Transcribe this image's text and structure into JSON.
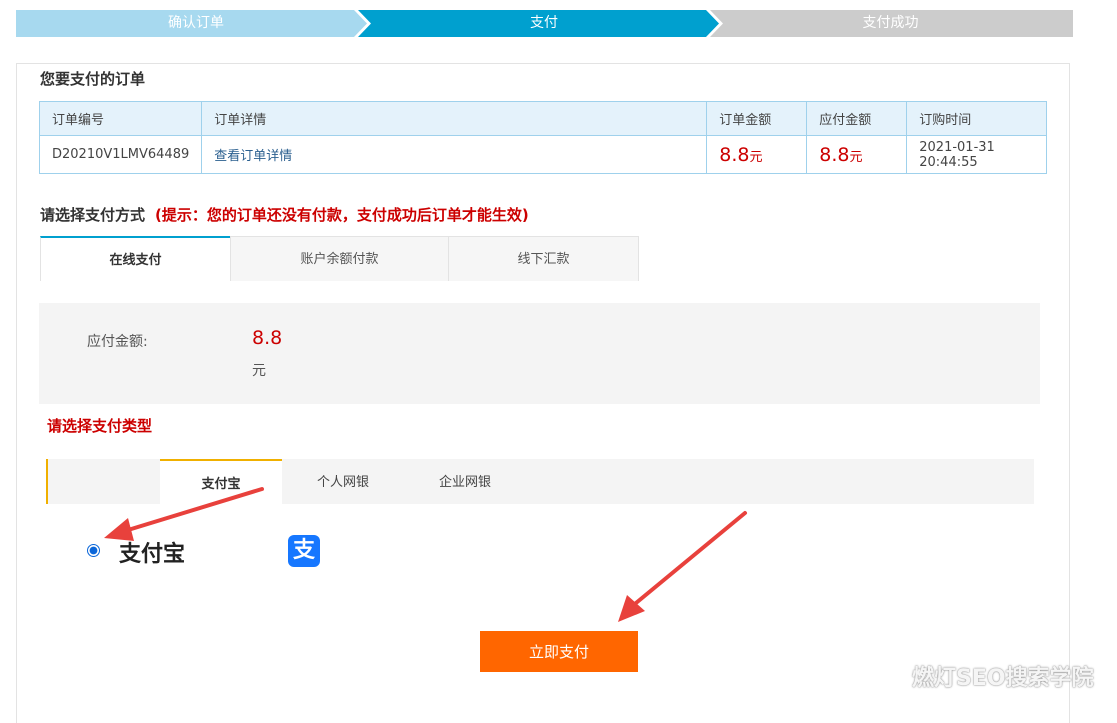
{
  "steps": [
    {
      "label": "确认订单"
    },
    {
      "label": "支付"
    },
    {
      "label": "支付成功"
    }
  ],
  "colors": {
    "step_done": "#a7d9ef",
    "step_active": "#00a0cf",
    "step_pending": "#cccccc",
    "price_red": "#cc0000",
    "pay_button": "#ff6600",
    "tab_accent": "#f0b000",
    "annotation_arrow": "#e8413c"
  },
  "order": {
    "title": "您要支付的订单",
    "headers": [
      "订单编号",
      "订单详情",
      "订单金额",
      "应付金额",
      "订购时间"
    ],
    "row": {
      "order_no": "D20210V1LMV64489",
      "detail_link": "查看订单详情",
      "order_amount": "8.8",
      "order_amount_unit": "元",
      "payable_amount": "8.8",
      "payable_amount_unit": "元",
      "order_time": "2021-01-31 20:44:55"
    }
  },
  "payment_method": {
    "title": "请选择支付方式",
    "hint": "(提示：您的订单还没有付款，支付成功后订单才能生效)",
    "tabs": [
      {
        "label": "在线支付",
        "active": true
      },
      {
        "label": "账户余额付款",
        "active": false
      },
      {
        "label": "线下汇款",
        "active": false
      }
    ]
  },
  "payable": {
    "label": "应付金额:",
    "amount": "8.8",
    "unit": "元"
  },
  "payment_type": {
    "title": "请选择支付类型",
    "tabs": [
      {
        "label": "支付宝",
        "active": true
      },
      {
        "label": "个人网银",
        "active": false
      },
      {
        "label": "企业网银",
        "active": false
      }
    ]
  },
  "alipay": {
    "label": "支付宝",
    "logo_glyph": "支",
    "icon": "alipay-logo-icon",
    "selected": true
  },
  "pay_button_label": "立即支付",
  "watermark": "燃灯SEO搜索学院"
}
